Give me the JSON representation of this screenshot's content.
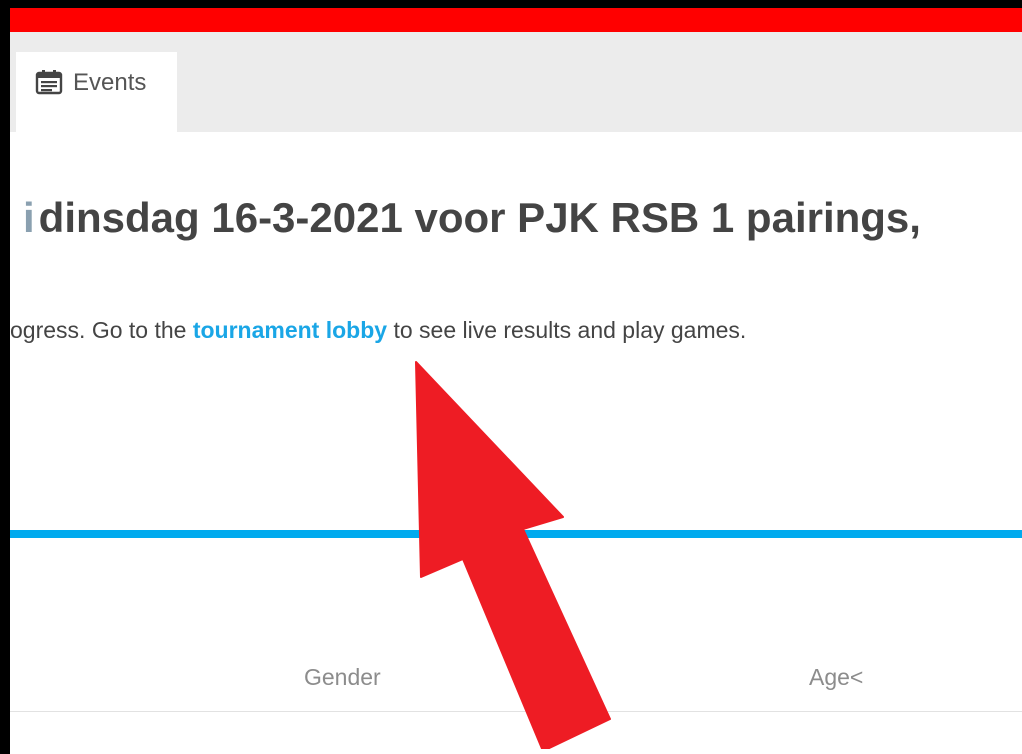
{
  "tab": {
    "label": "Events",
    "icon": "calendar-icon"
  },
  "page": {
    "title_lead": "i",
    "title": "dinsdag 16-3-2021 voor PJK RSB 1 pairings,",
    "status_prefix": "ogress. Go to the ",
    "status_link": "tournament lobby",
    "status_suffix": " to see live results and play games."
  },
  "table": {
    "columns": [
      "Gender",
      "Age<"
    ]
  },
  "colors": {
    "top_bar": "#ff0000",
    "link": "#1aa6e6",
    "rule": "#00aaee",
    "annotation_arrow": "#ee1c24"
  }
}
